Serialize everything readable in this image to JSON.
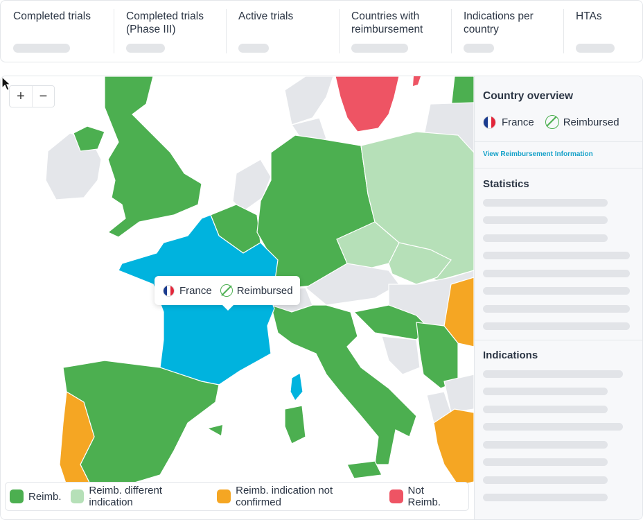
{
  "stats": [
    {
      "label": "Completed trials"
    },
    {
      "label": "Completed trials (Phase III)"
    },
    {
      "label": "Active trials"
    },
    {
      "label": "Countries with reimbursement"
    },
    {
      "label": "Indications per country"
    },
    {
      "label": "HTAs"
    }
  ],
  "map": {
    "zoom_in": "+",
    "zoom_out": "−",
    "tooltip": {
      "country": "France",
      "status": "Reimbursed"
    },
    "legend": [
      {
        "label": "Reimb.",
        "color": "#4caf50"
      },
      {
        "label": "Reimb. different indication",
        "color": "#b6e0b8"
      },
      {
        "label": "Reimb. indication not confirmed",
        "color": "#f5a623"
      },
      {
        "label": "Not Reimb.",
        "color": "#ee5464"
      }
    ],
    "selected_color": "#00b3de",
    "no_data_color": "#e4e6ea"
  },
  "side": {
    "title": "Country overview",
    "country": "France",
    "status": "Reimbursed",
    "link": "View Reimbursement Information",
    "statistics_heading": "Statistics",
    "indications_heading": "Indications"
  }
}
